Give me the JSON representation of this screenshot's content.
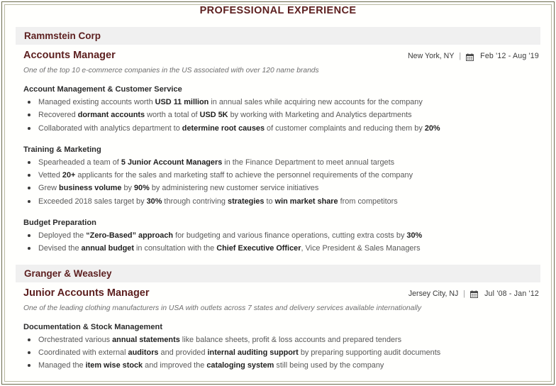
{
  "document": {
    "title": "PROFESSIONAL EXPERIENCE",
    "accent_color": "#5c1f1f",
    "band_color": "#f0f0f0",
    "border_color": "#6b6b4e"
  },
  "experience": [
    {
      "company": "Rammstein Corp",
      "role": "Accounts Manager",
      "location": "New York, NY",
      "separator": "|",
      "calendar_icon": "calendar-icon",
      "dates": "Feb '12 - Aug '19",
      "description": "One of the top 10 e-commerce companies in the US associated with over 120 name brands",
      "sections": [
        {
          "heading": "Account Management & Customer Service",
          "bullets": [
            [
              {
                "t": "Managed existing accounts worth ",
                "b": false
              },
              {
                "t": "USD 11 million",
                "b": true
              },
              {
                "t": " in annual sales while acquiring new accounts for the company",
                "b": false
              }
            ],
            [
              {
                "t": "Recovered ",
                "b": false
              },
              {
                "t": "dormant accounts",
                "b": true
              },
              {
                "t": " worth a total of ",
                "b": false
              },
              {
                "t": "USD 5K",
                "b": true
              },
              {
                "t": " by working with Marketing and Analytics departments",
                "b": false
              }
            ],
            [
              {
                "t": "Collaborated with analytics department to ",
                "b": false
              },
              {
                "t": "determine root causes",
                "b": true
              },
              {
                "t": " of customer complaints and reducing them by ",
                "b": false
              },
              {
                "t": "20%",
                "b": true
              }
            ]
          ]
        },
        {
          "heading": "Training & Marketing",
          "bullets": [
            [
              {
                "t": "Spearheaded a team of ",
                "b": false
              },
              {
                "t": "5 Junior Account Managers",
                "b": true
              },
              {
                "t": " in the Finance Department to meet annual targets",
                "b": false
              }
            ],
            [
              {
                "t": "Vetted ",
                "b": false
              },
              {
                "t": "20+",
                "b": true
              },
              {
                "t": " applicants for the sales and marketing staff to achieve the personnel requirements of the company",
                "b": false
              }
            ],
            [
              {
                "t": "Grew ",
                "b": false
              },
              {
                "t": "business volume",
                "b": true
              },
              {
                "t": " by ",
                "b": false
              },
              {
                "t": "90%",
                "b": true
              },
              {
                "t": " by administering new customer service initiatives",
                "b": false
              }
            ],
            [
              {
                "t": "Exceeded 2018 sales target by ",
                "b": false
              },
              {
                "t": "30%",
                "b": true
              },
              {
                "t": " through contriving ",
                "b": false
              },
              {
                "t": "strategies",
                "b": true
              },
              {
                "t": " to ",
                "b": false
              },
              {
                "t": "win market share",
                "b": true
              },
              {
                "t": " from competitors",
                "b": false
              }
            ]
          ]
        },
        {
          "heading": "Budget Preparation",
          "bullets": [
            [
              {
                "t": "Deployed the ",
                "b": false
              },
              {
                "t": "“Zero-Based” approach",
                "b": true
              },
              {
                "t": " for budgeting and various finance operations, cutting extra costs by ",
                "b": false
              },
              {
                "t": "30%",
                "b": true
              }
            ],
            [
              {
                "t": "Devised the ",
                "b": false
              },
              {
                "t": "annual budget",
                "b": true
              },
              {
                "t": " in consultation with the ",
                "b": false
              },
              {
                "t": "Chief Executive Officer",
                "b": true
              },
              {
                "t": ", Vice President & Sales Managers",
                "b": false
              }
            ]
          ]
        }
      ]
    },
    {
      "company": "Granger & Weasley",
      "role": "Junior Accounts Manager",
      "location": "Jersey City, NJ",
      "separator": "|",
      "calendar_icon": "calendar-icon",
      "dates": "Jul '08 - Jan '12",
      "description": "One of the leading clothing manufacturers in USA with outlets across 7 states and delivery services available internationally",
      "sections": [
        {
          "heading": "Documentation & Stock Management",
          "bullets": [
            [
              {
                "t": "Orchestrated various ",
                "b": false
              },
              {
                "t": "annual statements",
                "b": true
              },
              {
                "t": " like balance sheets, profit & loss accounts and prepared tenders",
                "b": false
              }
            ],
            [
              {
                "t": "Coordinated with external ",
                "b": false
              },
              {
                "t": "auditors",
                "b": true
              },
              {
                "t": " and provided ",
                "b": false
              },
              {
                "t": "internal auditing support",
                "b": true
              },
              {
                "t": " by preparing supporting audit documents",
                "b": false
              }
            ],
            [
              {
                "t": "Managed the ",
                "b": false
              },
              {
                "t": "item wise stock",
                "b": true
              },
              {
                "t": " and improved the ",
                "b": false
              },
              {
                "t": "cataloging system",
                "b": true
              },
              {
                "t": " still being used by the company",
                "b": false
              }
            ]
          ]
        }
      ]
    }
  ]
}
